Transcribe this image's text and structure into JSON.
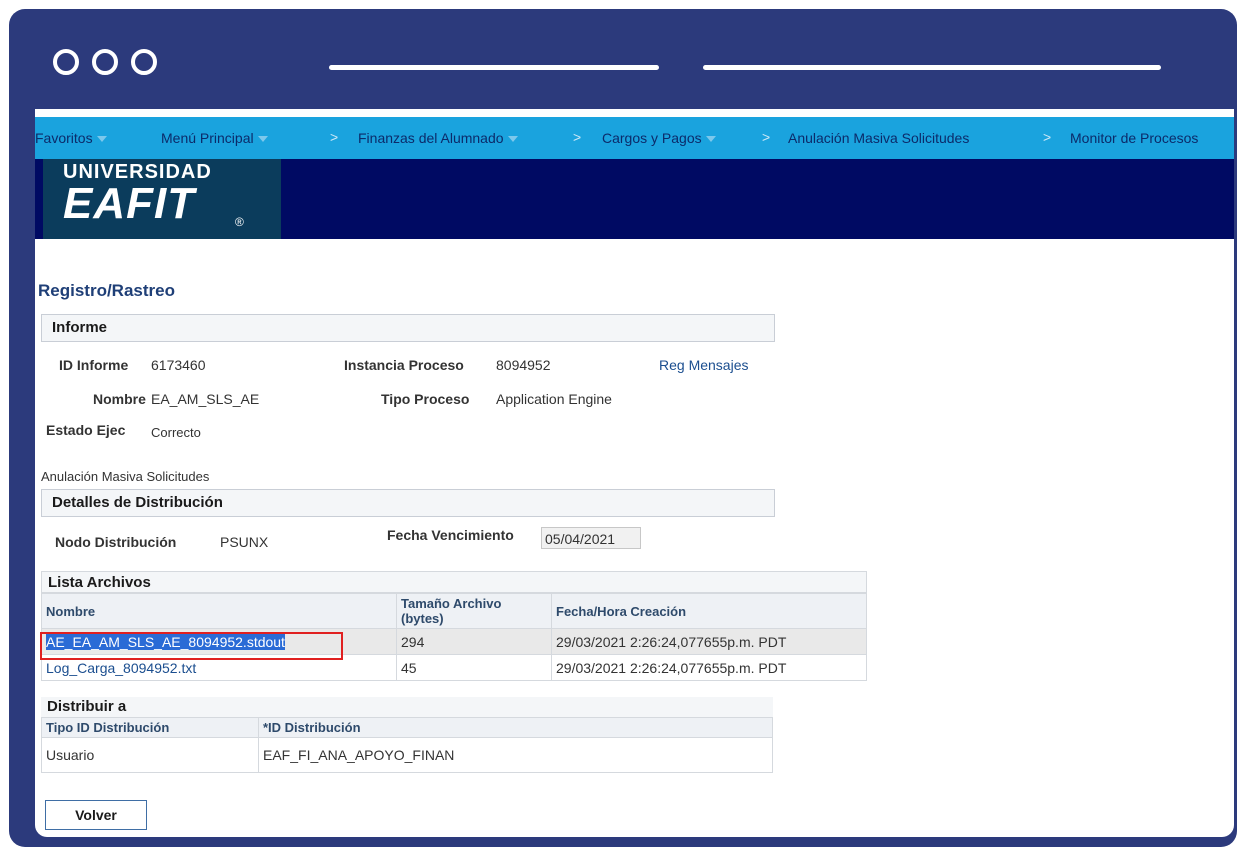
{
  "nav": {
    "items": [
      {
        "label": "Favoritos",
        "dropdown": true
      },
      {
        "label": "Menú Principal",
        "dropdown": true
      },
      {
        "label": "Finanzas del Alumnado",
        "dropdown": true
      },
      {
        "label": "Cargos y Pagos",
        "dropdown": true
      },
      {
        "label": "Anulación Masiva Solicitudes",
        "dropdown": false
      },
      {
        "label": "Monitor de Procesos",
        "dropdown": false
      }
    ],
    "separator": ">"
  },
  "logo": {
    "line1": "UNIVERSIDAD",
    "line2": "EAFIT",
    "mark": "®"
  },
  "page_title": "Registro/Rastreo",
  "informe": {
    "section_title": "Informe",
    "id_label": "ID Informe",
    "id_value": "6173460",
    "nombre_label": "Nombre",
    "nombre_value": "EA_AM_SLS_AE",
    "estado_label": "Estado Ejec",
    "estado_value": "Correcto",
    "instancia_label": "Instancia Proceso",
    "instancia_value": "8094952",
    "tipo_label": "Tipo Proceso",
    "tipo_value": "Application Engine",
    "reg_mensajes": "Reg Mensajes"
  },
  "description": "Anulación Masiva Solicitudes",
  "distribucion": {
    "section_title": "Detalles de Distribución",
    "nodo_label": "Nodo Distribución",
    "nodo_value": "PSUNX",
    "fecha_label": "Fecha Vencimiento",
    "fecha_value": "05/04/2021"
  },
  "archivos": {
    "title": "Lista Archivos",
    "headers": [
      "Nombre",
      "Tamaño Archivo (bytes)",
      "Fecha/Hora Creación"
    ],
    "rows": [
      {
        "nombre": "AE_EA_AM_SLS_AE_8094952.stdout",
        "tamano": "294",
        "fecha": "29/03/2021  2:26:24,077655p.m. PDT"
      },
      {
        "nombre": "Log_Carga_8094952.txt",
        "tamano": "45",
        "fecha": "29/03/2021  2:26:24,077655p.m. PDT"
      }
    ]
  },
  "distribuir": {
    "title": "Distribuir a",
    "headers": [
      "Tipo ID Distribución",
      "*ID Distribución"
    ],
    "rows": [
      {
        "tipo": "Usuario",
        "id": "EAF_FI_ANA_APOYO_FINAN"
      }
    ]
  },
  "volver_label": "Volver",
  "colors": {
    "frame": "#2c3a7c",
    "nav": "#1aa3de",
    "banner": "#000a63",
    "highlight": "#e02020"
  }
}
